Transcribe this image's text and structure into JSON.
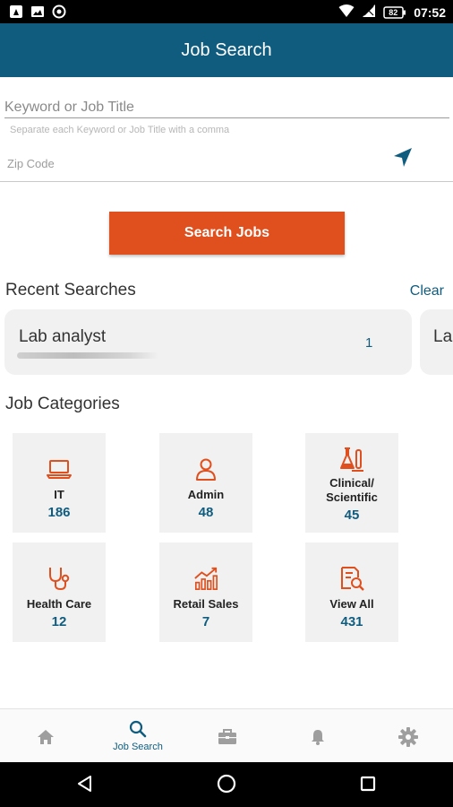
{
  "status_bar": {
    "time": "07:52",
    "battery": "82",
    "icons": [
      "image-icon",
      "vpn-icon",
      "wifi-icon",
      "signal-icon",
      "battery-icon"
    ]
  },
  "app_bar": {
    "title": "Job Search"
  },
  "search_form": {
    "keyword_placeholder": "Keyword or Job Title",
    "keyword_value": "",
    "keyword_hint": "Separate each Keyword or Job Title with a comma",
    "zip_placeholder": "Zip Code",
    "zip_value": "",
    "location_icon": "navigation-arrow-icon",
    "search_button_label": "Search Jobs"
  },
  "recent_searches": {
    "title": "Recent Searches",
    "clear_label": "Clear",
    "items": [
      {
        "term": "Lab analyst",
        "count": "1"
      },
      {
        "term": "Lab",
        "count": ""
      }
    ]
  },
  "job_categories": {
    "title": "Job Categories",
    "items": [
      {
        "label": "IT",
        "count": "186",
        "icon": "laptop-icon"
      },
      {
        "label": "Admin",
        "count": "48",
        "icon": "person-icon"
      },
      {
        "label": "Clinical/ Scientific",
        "count": "45",
        "icon": "lab-flask-icon"
      },
      {
        "label": "Health Care",
        "count": "12",
        "icon": "stethoscope-icon"
      },
      {
        "label": "Retail Sales",
        "count": "7",
        "icon": "growth-chart-icon"
      },
      {
        "label": "View All",
        "count": "431",
        "icon": "document-search-icon"
      }
    ]
  },
  "bottom_nav": {
    "items": [
      {
        "name": "home",
        "icon": "home-icon",
        "label": ""
      },
      {
        "name": "job-search",
        "icon": "search-icon",
        "label": "Job Search",
        "active": true
      },
      {
        "name": "jobs",
        "icon": "briefcase-icon",
        "label": ""
      },
      {
        "name": "alerts",
        "icon": "bell-icon",
        "label": ""
      },
      {
        "name": "settings",
        "icon": "gear-icon",
        "label": ""
      }
    ]
  },
  "colors": {
    "brand_blue": "#0f5c7f",
    "accent_orange": "#e0501e",
    "icon_orange": "#e0501e",
    "tile_bg": "#f1f1f1",
    "nav_inactive": "#9e9e9e"
  }
}
